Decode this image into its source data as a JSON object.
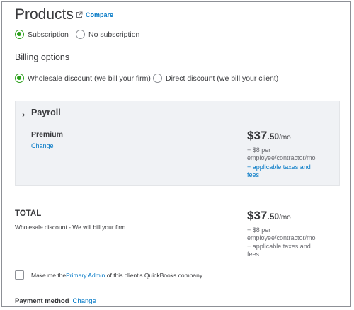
{
  "header": {
    "title": "Products",
    "compare_label": "Compare"
  },
  "subscription_options": {
    "selected": "Subscription",
    "items": [
      "Subscription",
      "No subscription"
    ]
  },
  "billing": {
    "title": "Billing options",
    "options": [
      "Wholesale discount (we bill your firm)",
      "Direct discount (we bill your client)"
    ],
    "selected": "Wholesale discount (we bill your firm)"
  },
  "product_card": {
    "name": "Payroll",
    "plan": "Premium",
    "change_label": "Change",
    "price_dollars": "$37",
    "price_cents": ".50",
    "price_unit": "/mo",
    "per_employee_line1": "+ $8 per",
    "per_employee_line2": "employee/contractor/mo",
    "taxes_line1": "+ applicable taxes and",
    "taxes_line2": "fees"
  },
  "total": {
    "label": "TOTAL",
    "note": "Wholesale discount - We will bill your firm.",
    "price_dollars": "$37",
    "price_cents": ".50",
    "price_unit": "/mo",
    "per_employee_line1": "+ $8 per",
    "per_employee_line2": "employee/contractor/mo",
    "taxes_line1": "+ applicable taxes and",
    "taxes_line2": "fees"
  },
  "primary_admin": {
    "prefix": "Make me the ",
    "link": "Primary Admin",
    "suffix": " of this client's QuickBooks company.",
    "checked": false
  },
  "payment": {
    "label": "Payment method",
    "change_label": "Change"
  },
  "colors": {
    "accent_green": "#2ca01c",
    "link_blue": "#0077c5",
    "card_bg": "#f0f2f5"
  }
}
